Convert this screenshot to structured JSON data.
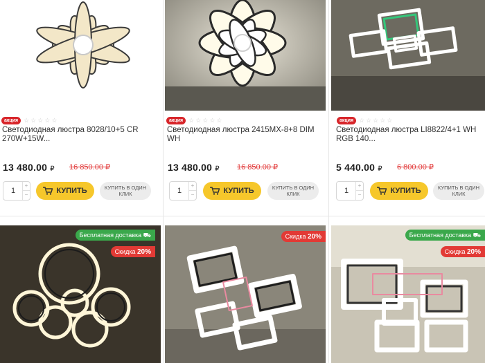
{
  "products": [
    {
      "sale_label": "акция",
      "rating_stars": [
        "☆",
        "☆",
        "☆",
        "☆",
        "☆"
      ],
      "title": "Светодиодная люстра 8028/10+5 CR 270W+15W...",
      "price": "13 480.00",
      "currency": "₽",
      "old_price": "16 850.00 ₽",
      "qty": "1",
      "buy_label": "КУПИТЬ",
      "oneclick_label": "КУПИТЬ В ОДИН КЛИК"
    },
    {
      "sale_label": "акция",
      "rating_stars": [
        "☆",
        "☆",
        "☆",
        "☆",
        "☆"
      ],
      "title": "Светодиодная люстра 2415MX-8+8 DIM WH",
      "price": "13 480.00",
      "currency": "₽",
      "old_price": "16 850.00 ₽",
      "qty": "1",
      "buy_label": "КУПИТЬ",
      "oneclick_label": "КУПИТЬ В ОДИН КЛИК"
    },
    {
      "sale_label": "акция",
      "rating_stars": [
        "☆",
        "☆",
        "☆",
        "☆",
        "☆"
      ],
      "title": "Светодиодная люстра LI8822/4+1 WH RGB 140...",
      "price": "5 440.00",
      "currency": "₽",
      "old_price": "6 800.00 ₽",
      "qty": "1",
      "buy_label": "КУПИТЬ",
      "oneclick_label": "КУПИТЬ В ОДИН КЛИК"
    }
  ],
  "bottom_cards": [
    {
      "shipping_label": "Бесплатная доставка",
      "discount_prefix": "Скидка",
      "discount_value": "20%"
    },
    {
      "shipping_label": "",
      "discount_prefix": "Скидка",
      "discount_value": "20%"
    },
    {
      "shipping_label": "Бесплатная доставка",
      "discount_prefix": "Скидка",
      "discount_value": "20%"
    }
  ],
  "icons": {
    "cart": "cart-icon",
    "truck": "truck-icon",
    "star": "star-outline-icon"
  },
  "colors": {
    "sale_badge": "#d8262b",
    "buy_button": "#f6c72b",
    "old_price": "#e23b3b",
    "shipping_tag": "#3aa84b",
    "discount_tag": "#e23a35"
  }
}
